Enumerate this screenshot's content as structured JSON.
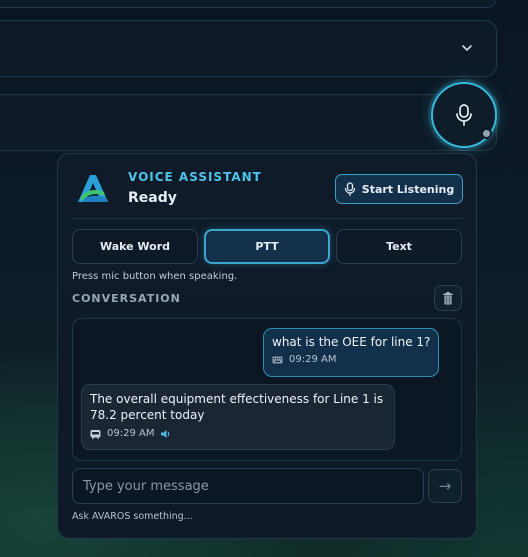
{
  "assistant": {
    "title": "VOICE ASSISTANT",
    "status": "Ready",
    "start_label": "Start Listening"
  },
  "modes": {
    "tabs": [
      {
        "label": "Wake Word",
        "active": false
      },
      {
        "label": "PTT",
        "active": true
      },
      {
        "label": "Text",
        "active": false
      }
    ],
    "hint": "Press mic button when speaking."
  },
  "conversation": {
    "label": "CONVERSATION",
    "messages": [
      {
        "role": "user",
        "text": "what is the OEE for line 1?",
        "time": "09:29 AM",
        "icon": "keyboard-icon"
      },
      {
        "role": "assistant",
        "text": "The overall equipment effectiveness for Line 1 is 78.2 percent today",
        "time": "09:29 AM",
        "icon": "bot-icon",
        "has_audio": true
      }
    ]
  },
  "composer": {
    "placeholder": "Type your message",
    "send_icon": "→",
    "footer": "Ask AVAROS something..."
  },
  "colors": {
    "accent": "#38b6d8",
    "panel_bg": "#0e1a27",
    "user_bubble": "#12304a",
    "bot_bubble": "#1a2634"
  }
}
